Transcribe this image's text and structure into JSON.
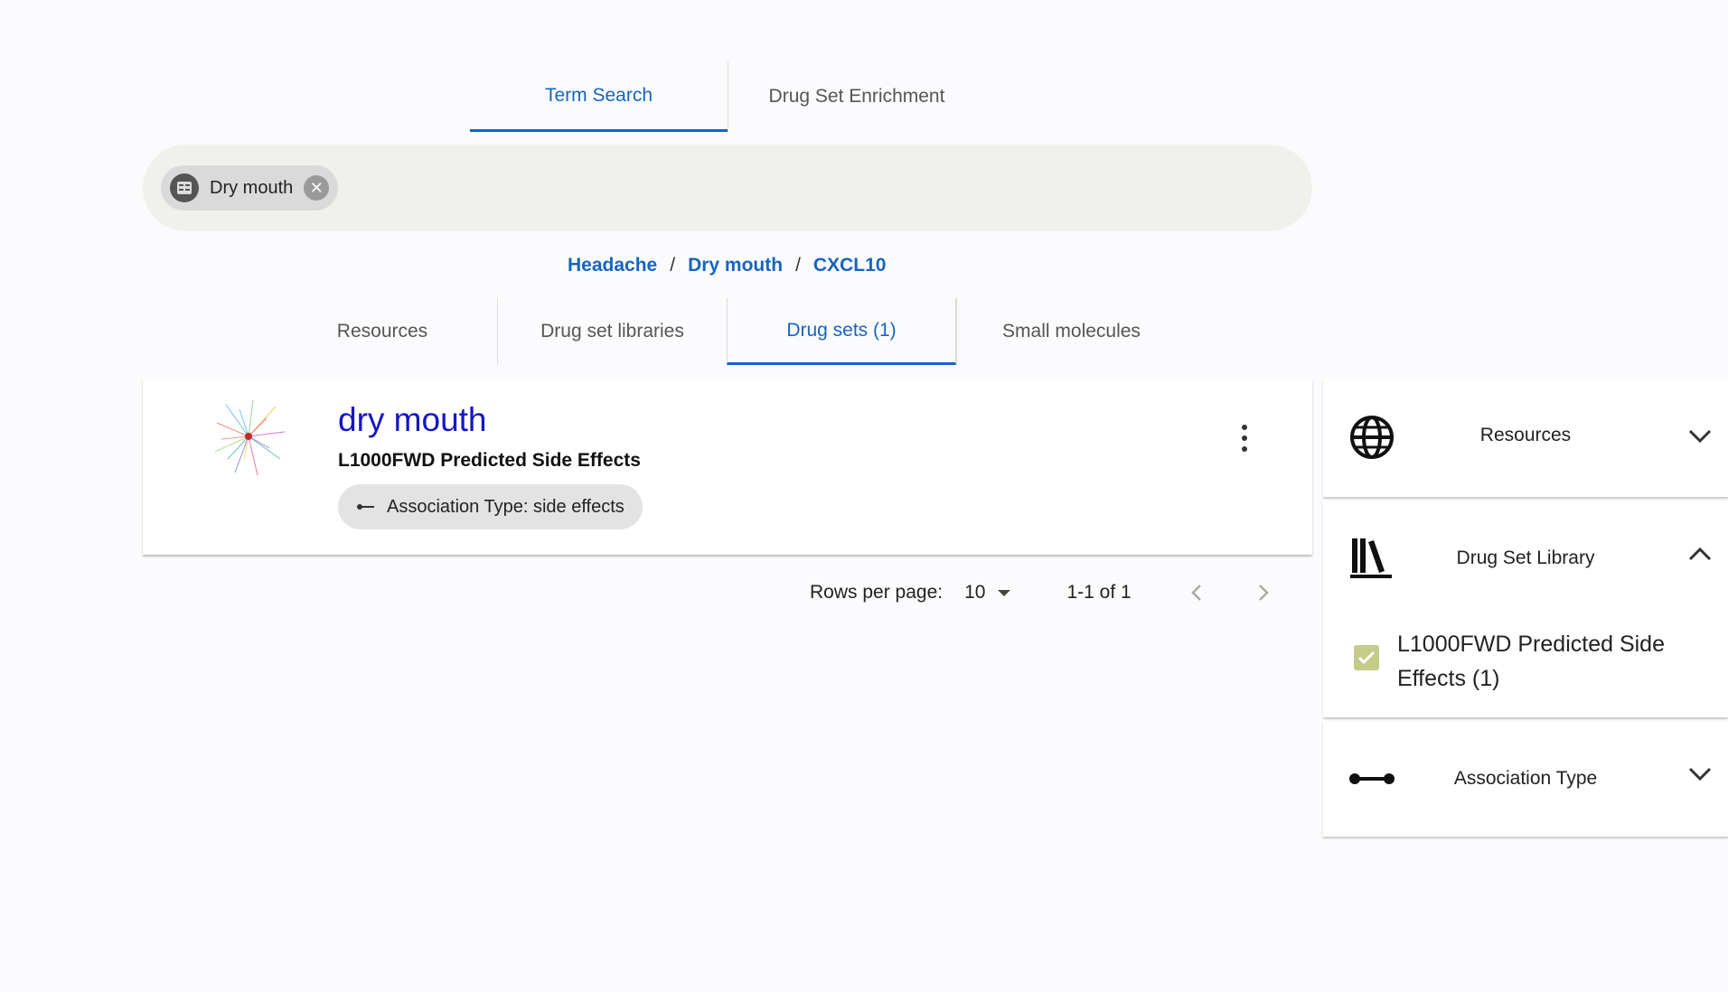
{
  "top_tabs": [
    {
      "label": "Term Search",
      "active": true
    },
    {
      "label": "Drug Set Enrichment",
      "active": false
    }
  ],
  "search": {
    "chips": [
      {
        "label": "Dry mouth",
        "icon": "library-icon"
      }
    ]
  },
  "breadcrumb": [
    "Headache",
    "Dry mouth",
    "CXCL10"
  ],
  "breadcrumb_separator": "/",
  "result_tabs": [
    {
      "label": "Resources",
      "active": false
    },
    {
      "label": "Drug set libraries",
      "active": false
    },
    {
      "label": "Drug sets (1)",
      "active": true
    },
    {
      "label": "Small molecules",
      "active": false
    }
  ],
  "result": {
    "title": "dry mouth",
    "library": "L1000FWD Predicted Side Effects",
    "association_chip": "Association Type: side effects"
  },
  "pagination": {
    "rows_per_page_label": "Rows per page:",
    "rows_per_page_value": "10",
    "range": "1-1 of 1"
  },
  "filters": {
    "resources": {
      "label": "Resources",
      "icon": "globe-icon",
      "expanded": false
    },
    "library": {
      "label": "Drug Set Library",
      "icon": "library-icon",
      "expanded": true,
      "options": [
        {
          "label": "L1000FWD Predicted Side Effects (1)",
          "checked": true
        }
      ]
    },
    "association": {
      "label": "Association Type",
      "icon": "association-icon",
      "expanded": false
    }
  },
  "colors": {
    "accent": "#1565c0",
    "title": "#1515c8",
    "checkbox": "#c5cc8a"
  }
}
